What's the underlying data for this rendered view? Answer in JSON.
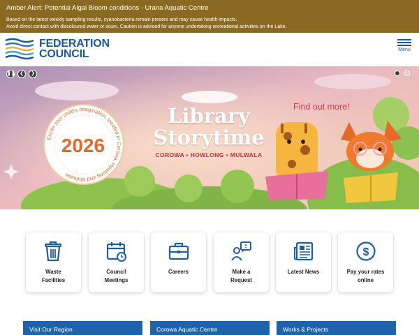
{
  "alert": {
    "title": "Amber Alert: Potential Algal Bloom conditions - Urana Aquatic Centre",
    "line1": "Based on the latest weekly sampling results, cyanobacteria remain present and may cause health impacts.",
    "line2": "Avoid direct contact with discoloured water or scum. Caution is advised for anyone undertaking recreational activities on the Lake."
  },
  "header": {
    "logo_line1": "FEDERATION",
    "logo_line2": "COUNCIL",
    "menu_label": "Menu",
    "menu_icon": "hamburger-icon"
  },
  "hero": {
    "title_line1": "Library",
    "title_line2": "Storytime",
    "subtitle": "COROWA • HOWLONG • MULWALA",
    "cta": "Find out more!",
    "badge_year": "2026",
    "badge_arc_text": "Excite your child's imagination, located in Corowa, Howlong and Mulwala",
    "controls": {
      "pause_icon": "pause-icon",
      "prev_icon": "chevron-left-icon",
      "next_icon": "chevron-right-icon"
    },
    "slide_count": 2,
    "active_slide": 1,
    "colors": {
      "title": "#ffffff",
      "subtitle": "#c12f4a",
      "cta": "#d23b52",
      "year": "#e46a2a"
    }
  },
  "quick_links": [
    {
      "line1": "Waste",
      "line2": "Facilities",
      "icon": "trash-bin-icon"
    },
    {
      "line1": "Council",
      "line2": "Meetings",
      "icon": "calendar-icon"
    },
    {
      "line1": "Careers",
      "line2": "",
      "icon": "briefcase-icon"
    },
    {
      "line1": "Make a",
      "line2": "Request",
      "icon": "person-request-icon"
    },
    {
      "line1": "Latest News",
      "line2": "",
      "icon": "newspaper-icon"
    },
    {
      "line1": "Pay your rates",
      "line2": "online",
      "icon": "dollar-circle-icon"
    }
  ],
  "cards": [
    {
      "label": "Visit Our Region"
    },
    {
      "label": "Corowa Aquatic Centre"
    },
    {
      "label": "Works & Projects"
    }
  ],
  "colors": {
    "alert_bg": "#8a6a23",
    "brand_blue": "#1a5a9a",
    "icon_blue": "#1f5d9e",
    "card_blue": "#1f63ad"
  }
}
